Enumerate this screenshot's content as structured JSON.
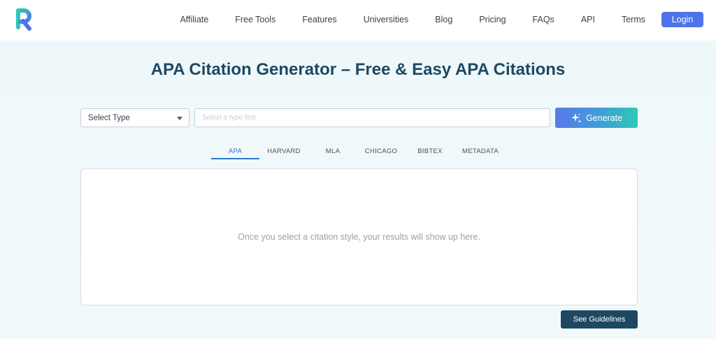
{
  "header": {
    "nav": [
      {
        "label": "Affiliate"
      },
      {
        "label": "Free Tools"
      },
      {
        "label": "Features"
      },
      {
        "label": "Universities"
      },
      {
        "label": "Blog"
      },
      {
        "label": "Pricing"
      },
      {
        "label": "FAQs"
      },
      {
        "label": "API"
      },
      {
        "label": "Terms"
      }
    ],
    "login_label": "Login",
    "logo_icon": "r-logo-icon"
  },
  "page_title": "APA Citation Generator – Free & Easy APA Citations",
  "form": {
    "type_select_value": "Select Type",
    "input_placeholder": "Select a type first",
    "input_value": "",
    "generate_label": "Generate",
    "generate_icon": "sparkle-icon"
  },
  "tabs": [
    {
      "label": "APA",
      "active": true
    },
    {
      "label": "HARVARD",
      "active": false
    },
    {
      "label": "MLA",
      "active": false
    },
    {
      "label": "CHICAGO",
      "active": false
    },
    {
      "label": "BIBTEX",
      "active": false
    },
    {
      "label": "METADATA",
      "active": false
    }
  ],
  "results": {
    "empty_message": "Once you select a citation style, your results will show up here."
  },
  "guidelines_label": "See Guidelines",
  "colors": {
    "brand_dark": "#1f4860",
    "login_blue": "#4f73e8",
    "tab_active": "#2f78c7",
    "generate_start": "#5a78ea",
    "generate_end": "#2ec9b6",
    "logo_teal": "#2ec9b6",
    "logo_blue": "#4f73e8"
  }
}
